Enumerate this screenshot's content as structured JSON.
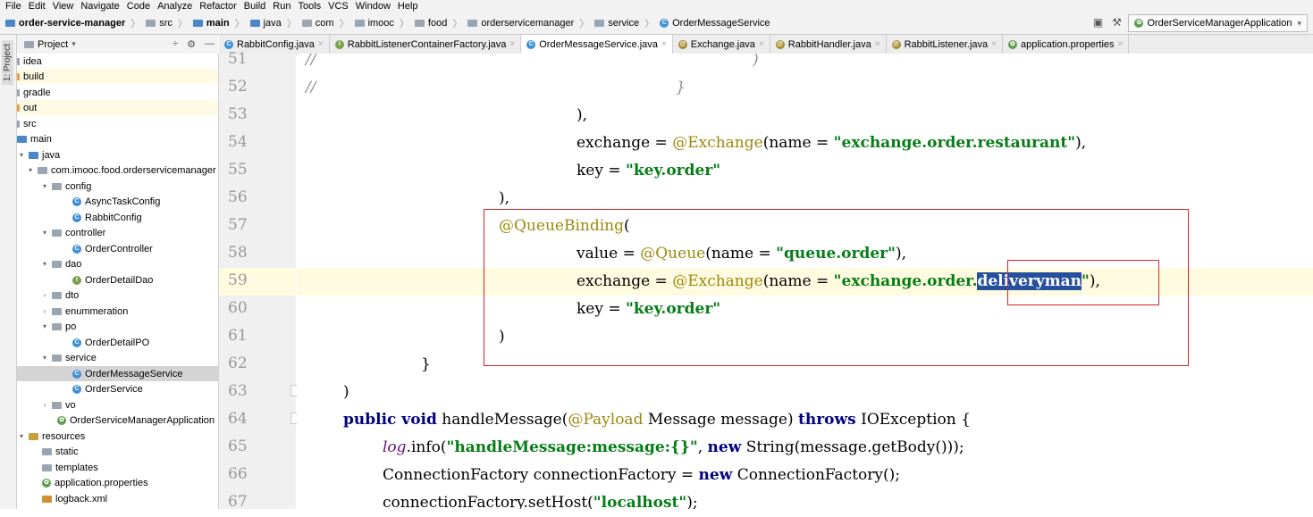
{
  "menu": [
    "File",
    "Edit",
    "View",
    "Navigate",
    "Code",
    "Analyze",
    "Refactor",
    "Build",
    "Run",
    "Tools",
    "VCS",
    "Window",
    "Help"
  ],
  "breadcrumbs": [
    "order-service-manager",
    "src",
    "main",
    "java",
    "com",
    "imooc",
    "food",
    "orderservicemanager",
    "service",
    "OrderMessageService"
  ],
  "run_config": "OrderServiceManagerApplication",
  "project_panel": {
    "label": "Project",
    "strip_label": "1: Project"
  },
  "tree": [
    {
      "label": "idea"
    },
    {
      "label": "build"
    },
    {
      "label": "gradle"
    },
    {
      "label": "out"
    },
    {
      "label": "src"
    },
    {
      "label": "main"
    },
    {
      "label": "java"
    },
    {
      "label": "com.imooc.food.orderservicemanager"
    },
    {
      "label": "config"
    },
    {
      "label": "AsyncTaskConfig"
    },
    {
      "label": "RabbitConfig"
    },
    {
      "label": "controller"
    },
    {
      "label": "OrderController"
    },
    {
      "label": "dao"
    },
    {
      "label": "OrderDetailDao"
    },
    {
      "label": "dto"
    },
    {
      "label": "enummeration"
    },
    {
      "label": "po"
    },
    {
      "label": "OrderDetailPO"
    },
    {
      "label": "service"
    },
    {
      "label": "OrderMessageService"
    },
    {
      "label": "OrderService"
    },
    {
      "label": "vo"
    },
    {
      "label": "OrderServiceManagerApplication"
    },
    {
      "label": "resources"
    },
    {
      "label": "static"
    },
    {
      "label": "templates"
    },
    {
      "label": "application.properties"
    },
    {
      "label": "logback.xml"
    }
  ],
  "tabs": [
    "RabbitConfig.java",
    "RabbitListenerContainerFactory.java",
    "OrderMessageService.java",
    "Exchange.java",
    "RabbitHandler.java",
    "RabbitListener.java",
    "application.properties"
  ],
  "active_tab": "OrderMessageService.java",
  "line_numbers": [
    "51",
    "52",
    "53",
    "54",
    "55",
    "56",
    "57",
    "58",
    "59",
    "60",
    "61",
    "62",
    "63",
    "64",
    "65",
    "66",
    "67"
  ],
  "code": {
    "l51": "//",
    "l51b": ")",
    "l52": "//",
    "l52b": "}",
    "l53": "),",
    "l54a": "exchange = ",
    "l54ann": "@Exchange",
    "l54b": "(name = ",
    "l54str": "\"exchange.order.restaurant\"",
    "l54c": "),",
    "l55a": "key = ",
    "l55str": "\"key.order\"",
    "l56": "),",
    "l57ann": "@QueueBinding",
    "l57b": "(",
    "l58a": "value = ",
    "l58ann": "@Queue",
    "l58b": "(name = ",
    "l58str": "\"queue.order\"",
    "l58c": "),",
    "l59a": "exchange = ",
    "l59ann": "@Exchange",
    "l59b": "(name = ",
    "l59str1": "\"exchange.order.",
    "l59sel": "deliveryman",
    "l59str2": "\"",
    "l59c": "),",
    "l60a": "key = ",
    "l60str": "\"key.order\"",
    "l61": ")",
    "l62": "}",
    "l63": ")",
    "l64kw1": "public void",
    "l64a": " handleMessage(",
    "l64ann": "@Payload",
    "l64b": " Message message) ",
    "l64kw2": "throws",
    "l64c": " IOException {",
    "l65field": "log",
    "l65a": ".info(",
    "l65str": "\"handleMessage:message:{}\"",
    "l65b": ", ",
    "l65kw": "new",
    "l65c": " String(message.getBody()));",
    "l66a": "ConnectionFactory connectionFactory = ",
    "l66kw": "new",
    "l66b": " ConnectionFactory();",
    "l67a": "connectionFactory.setHost(",
    "l67str": "\"localhost\"",
    "l67b": ");"
  }
}
